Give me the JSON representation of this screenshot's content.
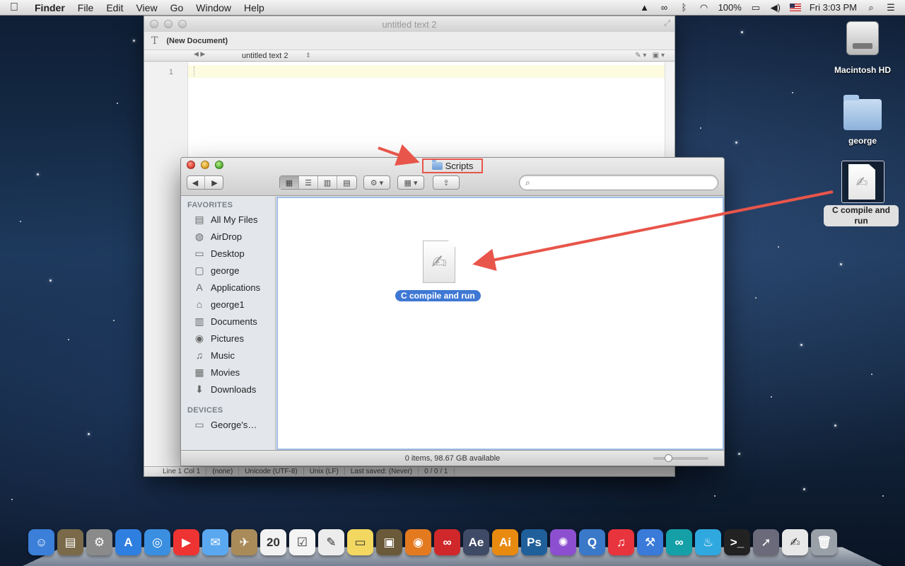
{
  "menubar": {
    "app": "Finder",
    "items": [
      "File",
      "Edit",
      "View",
      "Go",
      "Window",
      "Help"
    ],
    "battery": "100%",
    "clock": "Fri 3:03 PM"
  },
  "editor": {
    "title": "untitled text 2",
    "doc_label": "(New Document)",
    "tab_name": "untitled text 2",
    "line_number": "1",
    "status": {
      "position": "Line 1 Col 1",
      "language": "(none)",
      "encoding": "Unicode (UTF-8)",
      "line_endings": "Unix (LF)",
      "last_saved": "Last saved: (Never)",
      "counts": "0 / 0 / 1"
    }
  },
  "finder": {
    "title": "Scripts",
    "favorites_header": "FAVORITES",
    "favorites": [
      {
        "label": "All My Files",
        "icon": "all-files-icon"
      },
      {
        "label": "AirDrop",
        "icon": "airdrop-icon"
      },
      {
        "label": "Desktop",
        "icon": "desktop-icon"
      },
      {
        "label": "george",
        "icon": "folder-icon"
      },
      {
        "label": "Applications",
        "icon": "applications-icon"
      },
      {
        "label": "george1",
        "icon": "home-icon"
      },
      {
        "label": "Documents",
        "icon": "documents-icon"
      },
      {
        "label": "Pictures",
        "icon": "pictures-icon"
      },
      {
        "label": "Music",
        "icon": "music-icon"
      },
      {
        "label": "Movies",
        "icon": "movies-icon"
      },
      {
        "label": "Downloads",
        "icon": "downloads-icon"
      }
    ],
    "devices_header": "DEVICES",
    "devices": [
      {
        "label": "George's…",
        "icon": "laptop-icon"
      }
    ],
    "file_name": "C compile and run",
    "status": "0 items, 98.67 GB available"
  },
  "desktop": {
    "hd_label": "Macintosh HD",
    "folder_label": "george",
    "script_label": "C compile and run"
  },
  "colors": {
    "annotation": "#e8554a",
    "selection": "#3f78d4"
  },
  "dock": [
    {
      "name": "finder",
      "glyph": "☺",
      "color": "#3b7fd8"
    },
    {
      "name": "image-capture",
      "glyph": "▤",
      "color": "#7a6a4a"
    },
    {
      "name": "system-preferences",
      "glyph": "⚙",
      "color": "#8a8a8a"
    },
    {
      "name": "app-store",
      "glyph": "A",
      "color": "#2f7fe0"
    },
    {
      "name": "safari",
      "glyph": "◎",
      "color": "#3a8fe0"
    },
    {
      "name": "youtube",
      "glyph": "▶",
      "color": "#e33"
    },
    {
      "name": "messages",
      "glyph": "✉",
      "color": "#5aa8f0"
    },
    {
      "name": "mail",
      "glyph": "✈",
      "color": "#a98b5a"
    },
    {
      "name": "calendar",
      "glyph": "20",
      "color": "#f2f2f2"
    },
    {
      "name": "reminders",
      "glyph": "☑",
      "color": "#f4f4f4"
    },
    {
      "name": "textedit",
      "glyph": "✎",
      "color": "#ececec"
    },
    {
      "name": "stickies",
      "glyph": "▭",
      "color": "#f2d860"
    },
    {
      "name": "iphoto",
      "glyph": "▣",
      "color": "#6a5a3a"
    },
    {
      "name": "blender",
      "glyph": "◉",
      "color": "#e47a20"
    },
    {
      "name": "creative-cloud",
      "glyph": "∞",
      "color": "#d0282a"
    },
    {
      "name": "after-effects",
      "glyph": "Ae",
      "color": "#3e4a66"
    },
    {
      "name": "illustrator",
      "glyph": "Ai",
      "color": "#e88a10"
    },
    {
      "name": "photoshop",
      "glyph": "Ps",
      "color": "#1f5f9a"
    },
    {
      "name": "color-picker",
      "glyph": "✺",
      "color": "#8c4fd0"
    },
    {
      "name": "quicktime",
      "glyph": "Q",
      "color": "#3a78c8"
    },
    {
      "name": "itunes",
      "glyph": "♫",
      "color": "#e8343c"
    },
    {
      "name": "xcode",
      "glyph": "⚒",
      "color": "#3a7ad8"
    },
    {
      "name": "arduino",
      "glyph": "∞",
      "color": "#15a0a8"
    },
    {
      "name": "processing",
      "glyph": "♨",
      "color": "#2fa8e0"
    },
    {
      "name": "terminal",
      "glyph": ">_",
      "color": "#222"
    },
    {
      "name": "launchpad",
      "glyph": "➚",
      "color": "#6a6a7a"
    },
    {
      "name": "script-doc",
      "glyph": "✍",
      "color": "#e8e8e8"
    },
    {
      "name": "trash",
      "glyph": "🗑",
      "color": "#9aa0a8"
    }
  ]
}
